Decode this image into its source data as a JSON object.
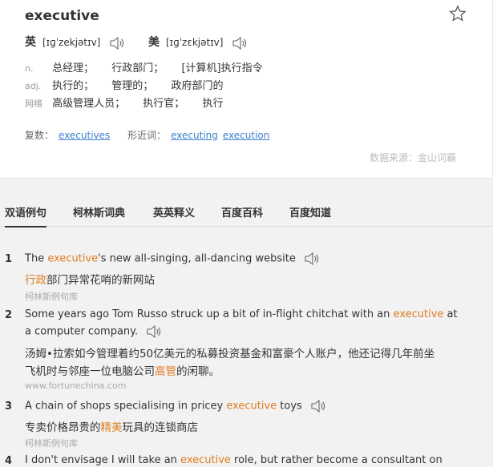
{
  "word": "executive",
  "pronunciations": [
    {
      "lang": "英",
      "ipa": "[ɪɡˈzekjətɪv]"
    },
    {
      "lang": "美",
      "ipa": "[ɪɡˈzɛkjətɪv]"
    }
  ],
  "definitions": [
    {
      "pos": "n.",
      "meanings": [
        "总经理；",
        "行政部门；",
        "[计算机]执行指令"
      ]
    },
    {
      "pos": "adj.",
      "meanings": [
        "执行的；",
        "管理的；",
        "政府部门的"
      ]
    },
    {
      "pos": "网络",
      "meanings": [
        "高级管理人员；",
        "执行官；",
        "执行"
      ]
    }
  ],
  "forms": {
    "plural_label": "复数：",
    "plural": "executives",
    "similar_label": "形近词：",
    "similar": [
      "executing",
      "execution"
    ]
  },
  "source": "数据来源：金山词霸",
  "tabs": [
    "双语例句",
    "柯林斯词典",
    "英英释义",
    "百度百科",
    "百度知道"
  ],
  "examples": {
    "e1": {
      "num": "1",
      "en_pre": "The ",
      "en_hl": "executive",
      "en_post": "'s new all-singing, all-dancing website",
      "cn_hl": "行政",
      "cn_post": "部门异常花哨的新网站",
      "src": "柯林斯例句库"
    },
    "e2": {
      "num": "2",
      "en_pre": "Some years ago Tom Russo struck up a bit of in-flight chitchat with an ",
      "en_hl": "executive",
      "en_post": " at",
      "en_line2": "a computer company.",
      "cn_line1": "汤姆•拉索如今管理着约50亿美元的私募投资基金和富豪个人账户，他还记得几年前坐",
      "cn_pre2": "飞机时与邻座一位电脑公司",
      "cn_hl2": "高管",
      "cn_post2": "的闲聊。",
      "src": "www.fortunechina.com"
    },
    "e3": {
      "num": "3",
      "en_pre": "A chain of shops specialising in pricey ",
      "en_hl": "executive",
      "en_post": " toys",
      "cn_pre": "专卖价格昂贵的",
      "cn_hl": "精美",
      "cn_post": "玩具的连锁商店",
      "src": "柯林斯例句库"
    },
    "e4": {
      "num": "4",
      "en_pre": "I don't envisage I will take an ",
      "en_hl": "executive",
      "en_post": " role, but rather become a consultant on"
    }
  }
}
